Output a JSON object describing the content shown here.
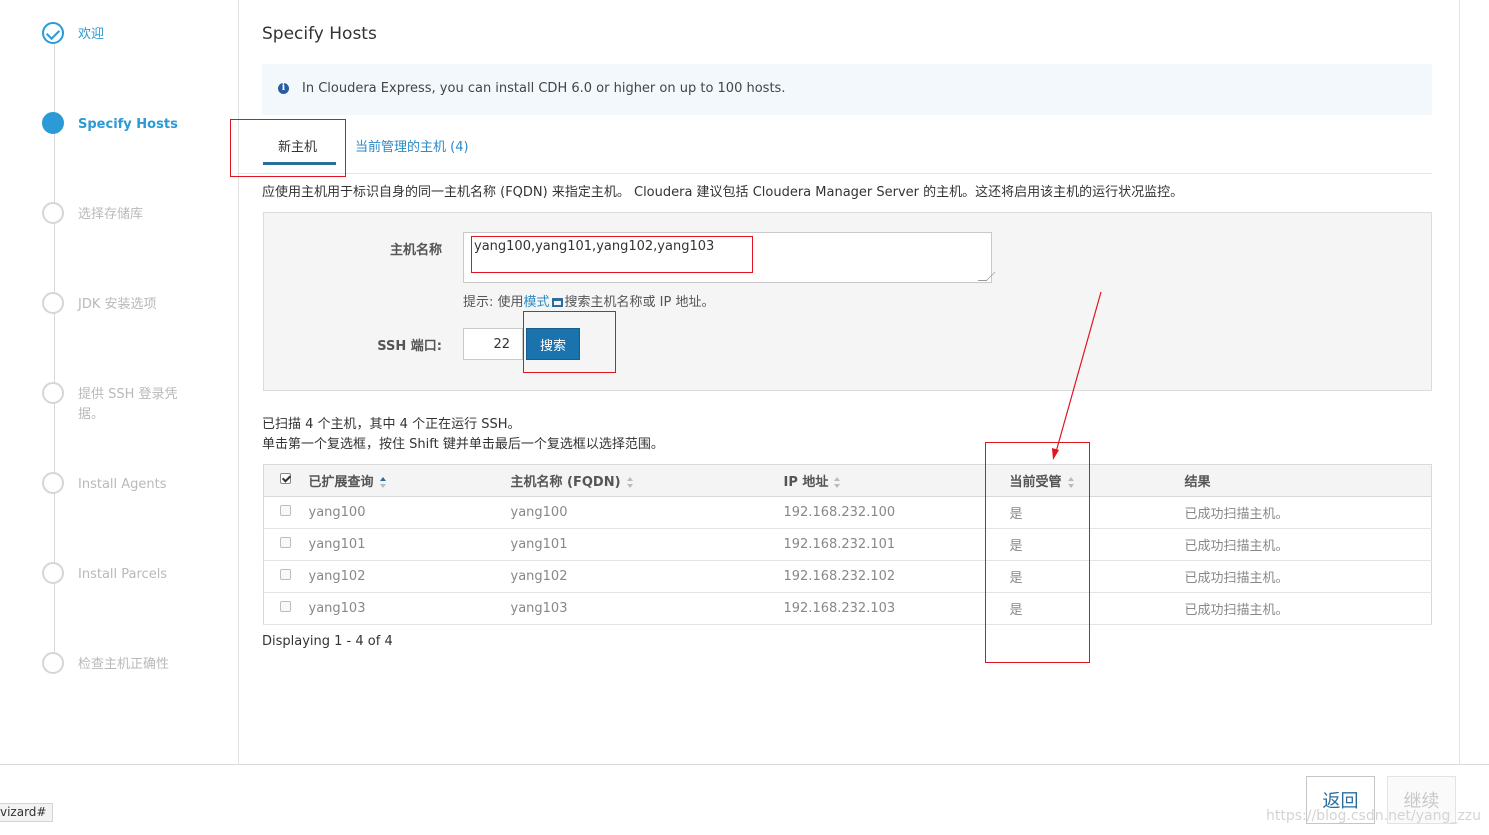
{
  "sidebar": {
    "steps": [
      {
        "label": "欢迎",
        "state": "done"
      },
      {
        "label": "Specify Hosts",
        "state": "active"
      },
      {
        "label": "选择存储库",
        "state": "pending"
      },
      {
        "label": "JDK 安装选项",
        "state": "pending"
      },
      {
        "label": "提供 SSH 登录凭据。",
        "state": "pending"
      },
      {
        "label": "Install Agents",
        "state": "pending"
      },
      {
        "label": "Install Parcels",
        "state": "pending"
      },
      {
        "label": "检查主机正确性",
        "state": "pending"
      }
    ]
  },
  "main": {
    "title": "Specify Hosts",
    "info": "In Cloudera Express, you can install CDH 6.0 or higher on up to 100 hosts.",
    "tabs": {
      "new_hosts": "新主机",
      "managed_hosts": "当前管理的主机 (4)"
    },
    "description": "应使用主机用于标识自身的同一主机名称 (FQDN) 来指定主机。 Cloudera 建议包括 Cloudera Manager Server 的主机。这还将启用该主机的运行状况监控。",
    "form": {
      "hostname_label": "主机名称",
      "hostname_value": "yang100,yang101,yang102,yang103",
      "hint_prefix": "提示: 使用",
      "hint_link": "模式",
      "hint_suffix": "搜索主机名称或 IP 地址。",
      "ssh_label": "SSH 端口:",
      "ssh_value": "22",
      "search_button": "搜索"
    },
    "scan_status_1": "已扫描 4 个主机，其中 4 个正在运行 SSH。",
    "scan_status_2": "单击第一个复选框，按住 Shift 键并单击最后一个复选框以选择范围。",
    "table": {
      "headers": [
        "已扩展查询",
        "主机名称 (FQDN)",
        "IP 地址",
        "当前受管",
        "结果"
      ],
      "rows": [
        {
          "query": "yang100",
          "fqdn": "yang100",
          "ip": "192.168.232.100",
          "managed": "是",
          "result": "已成功扫描主机。"
        },
        {
          "query": "yang101",
          "fqdn": "yang101",
          "ip": "192.168.232.101",
          "managed": "是",
          "result": "已成功扫描主机。"
        },
        {
          "query": "yang102",
          "fqdn": "yang102",
          "ip": "192.168.232.102",
          "managed": "是",
          "result": "已成功扫描主机。"
        },
        {
          "query": "yang103",
          "fqdn": "yang103",
          "ip": "192.168.232.103",
          "managed": "是",
          "result": "已成功扫描主机。"
        }
      ]
    },
    "displaying": "Displaying 1 - 4 of 4"
  },
  "footer": {
    "back_button": "返回",
    "next_button": "继续",
    "status_url": "vizard#",
    "watermark": "https://blog.csdn.net/yang_zzu"
  },
  "colors": {
    "accent": "#2b9ad6",
    "primary_button": "#1a73ac",
    "annotation": "#e0141e"
  }
}
